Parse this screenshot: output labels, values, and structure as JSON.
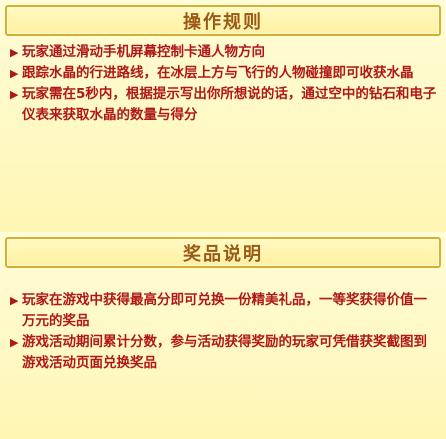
{
  "colors": {
    "panel_bg": "#fff6b4",
    "header_border": "#d8ae2e",
    "header_text": "#9a5a10",
    "body_text": "#b01818"
  },
  "rules_section": {
    "title": "操作规则",
    "items": [
      "玩家通过滑动手机屏幕控制卡通人物方向",
      "跟踪水晶的行进路线，在冰层上方与飞行的人物碰撞即可收获水晶",
      "玩家需在5秒内，根据提示写出你所想说的话，通过空中的钻石和电子仪表来获取水晶的数量与得分"
    ]
  },
  "rewards_section": {
    "title": "奖品说明",
    "items": [
      "玩家在游戏中获得最高分即可兑换一份精美礼品，一等奖获得价值一万元的奖品",
      "游戏活动期间累计分数，参与活动获得奖励的玩家可凭借获奖截图到游戏活动页面兑换奖品"
    ]
  }
}
